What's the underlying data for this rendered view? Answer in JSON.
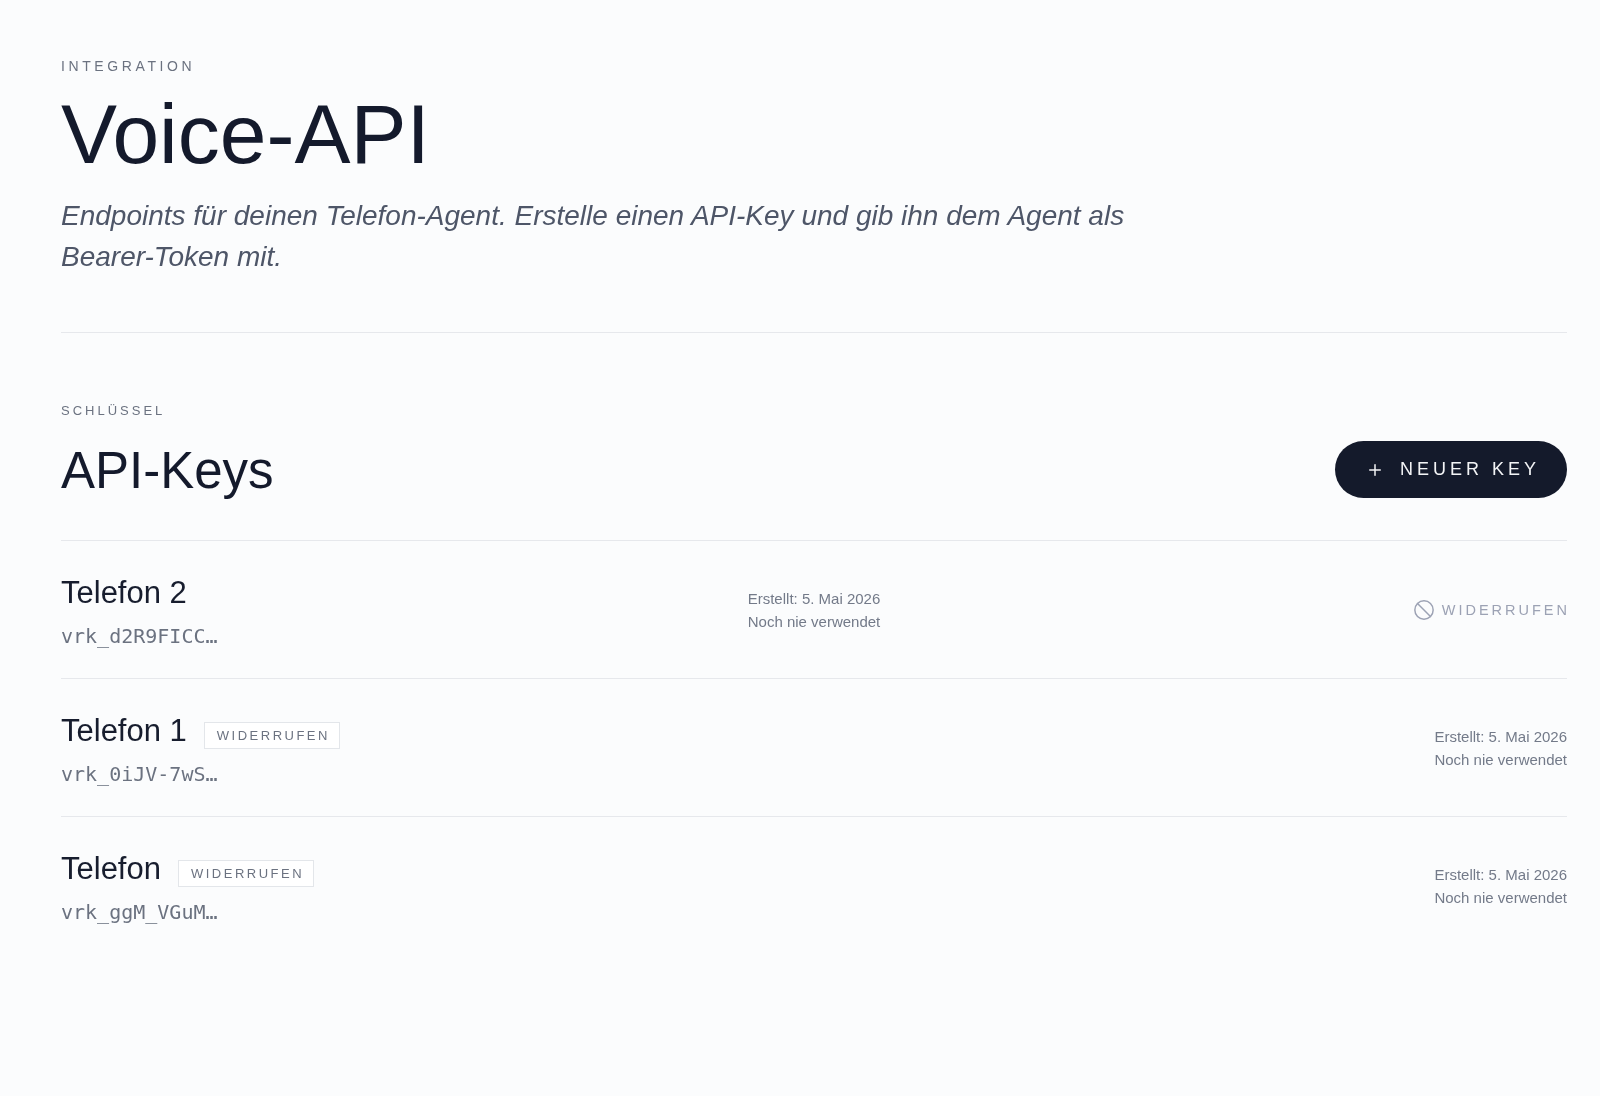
{
  "header": {
    "eyebrow": "INTEGRATION",
    "title": "Voice-API",
    "description": "Endpoints für deinen Telefon-Agent. Erstelle einen API-Key und gib ihn dem Agent als Bearer-Token mit."
  },
  "keys_section": {
    "eyebrow": "SCHLÜSSEL",
    "title": "API-Keys",
    "new_button": {
      "label": "NEUER KEY"
    },
    "keys": [
      {
        "name": "Telefon 2",
        "prefix": "vrk_d2R9FICC…",
        "created": "Erstellt: 5. Mai 2026",
        "usage": "Noch nie verwendet",
        "revoked": false,
        "revoke_button": "WIDERRUFEN"
      },
      {
        "name": "Telefon 1",
        "prefix": "vrk_0iJV-7wS…",
        "created": "Erstellt: 5. Mai 2026",
        "usage": "Noch nie verwendet",
        "revoked": true,
        "status_badge": "WIDERRUFEN"
      },
      {
        "name": "Telefon",
        "prefix": "vrk_ggM_VGuM…",
        "created": "Erstellt: 5. Mai 2026",
        "usage": "Noch nie verwendet",
        "revoked": true,
        "status_badge": "WIDERRUFEN"
      }
    ]
  }
}
